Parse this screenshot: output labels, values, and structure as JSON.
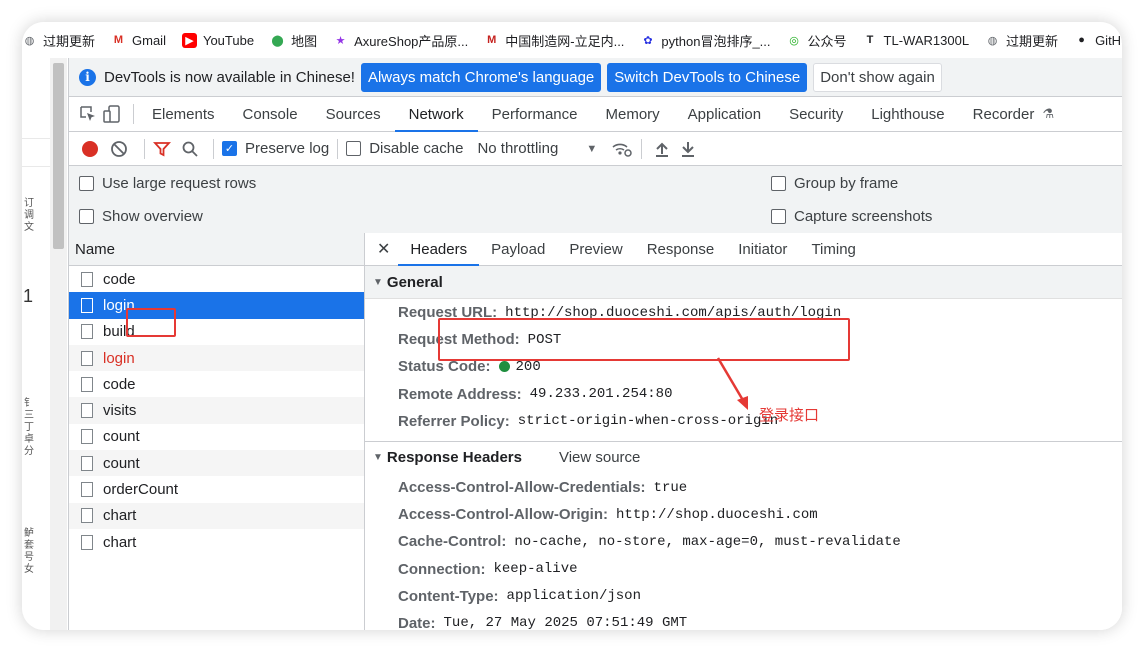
{
  "bookmarks": [
    {
      "label": "过期更新",
      "icon": "globe-icon"
    },
    {
      "label": "Gmail",
      "icon": "gmail-icon"
    },
    {
      "label": "YouTube",
      "icon": "youtube-icon"
    },
    {
      "label": "地图",
      "icon": "maps-icon"
    },
    {
      "label": "AxureShop产品原...",
      "icon": "star-icon"
    },
    {
      "label": "中国制造网-立足内...",
      "icon": "mic-logo-icon"
    },
    {
      "label": "python冒泡排序_...",
      "icon": "baidu-paw-icon"
    },
    {
      "label": "公众号",
      "icon": "wechat-icon"
    },
    {
      "label": "TL-WAR1300L",
      "icon": "tplink-icon"
    },
    {
      "label": "过期更新",
      "icon": "globe-icon"
    },
    {
      "label": "GitHu",
      "icon": "github-icon"
    }
  ],
  "infobar": {
    "message": "DevTools is now available in Chinese!",
    "btn_match": "Always match Chrome's language",
    "btn_switch": "Switch DevTools to Chinese",
    "btn_dismiss": "Don't show again"
  },
  "tabs": [
    "Elements",
    "Console",
    "Sources",
    "Network",
    "Performance",
    "Memory",
    "Application",
    "Security",
    "Lighthouse",
    "Recorder"
  ],
  "active_tab": "Network",
  "toolbar": {
    "preserve_log": "Preserve log",
    "disable_cache": "Disable cache",
    "throttling": "No throttling"
  },
  "settings": {
    "large_rows": "Use large request rows",
    "overview": "Show overview",
    "group_frame": "Group by frame",
    "capture": "Capture screenshots"
  },
  "name_header": "Name",
  "requests": [
    {
      "name": "code",
      "state": "normal"
    },
    {
      "name": "login",
      "state": "selected"
    },
    {
      "name": "build",
      "state": "normal"
    },
    {
      "name": "login",
      "state": "error"
    },
    {
      "name": "code",
      "state": "normal"
    },
    {
      "name": "visits",
      "state": "normal"
    },
    {
      "name": "count",
      "state": "normal"
    },
    {
      "name": "count",
      "state": "normal"
    },
    {
      "name": "orderCount",
      "state": "normal"
    },
    {
      "name": "chart",
      "state": "normal"
    },
    {
      "name": "chart",
      "state": "normal"
    }
  ],
  "detail_tabs": [
    "Headers",
    "Payload",
    "Preview",
    "Response",
    "Initiator",
    "Timing"
  ],
  "general": {
    "title": "General",
    "items": [
      {
        "key": "Request URL:",
        "value": "http://shop.duoceshi.com/apis/auth/login"
      },
      {
        "key": "Request Method:",
        "value": "POST"
      },
      {
        "key": "Status Code:",
        "value": "200"
      },
      {
        "key": "Remote Address:",
        "value": "49.233.201.254:80"
      },
      {
        "key": "Referrer Policy:",
        "value": "strict-origin-when-cross-origin"
      }
    ]
  },
  "response_headers": {
    "title": "Response Headers",
    "view_source": "View source",
    "items": [
      {
        "key": "Access-Control-Allow-Credentials:",
        "value": "true"
      },
      {
        "key": "Access-Control-Allow-Origin:",
        "value": "http://shop.duoceshi.com"
      },
      {
        "key": "Cache-Control:",
        "value": "no-cache, no-store, max-age=0, must-revalidate"
      },
      {
        "key": "Connection:",
        "value": "keep-alive"
      },
      {
        "key": "Content-Type:",
        "value": "application/json"
      },
      {
        "key": "Date:",
        "value": "Tue, 27 May 2025 07:51:49 GMT"
      }
    ]
  },
  "annotation": "登录接口",
  "colors": {
    "accent": "#1a73e8",
    "annotation": "#e53935",
    "status_ok": "#1e8e3e",
    "error_text": "#d93025"
  }
}
